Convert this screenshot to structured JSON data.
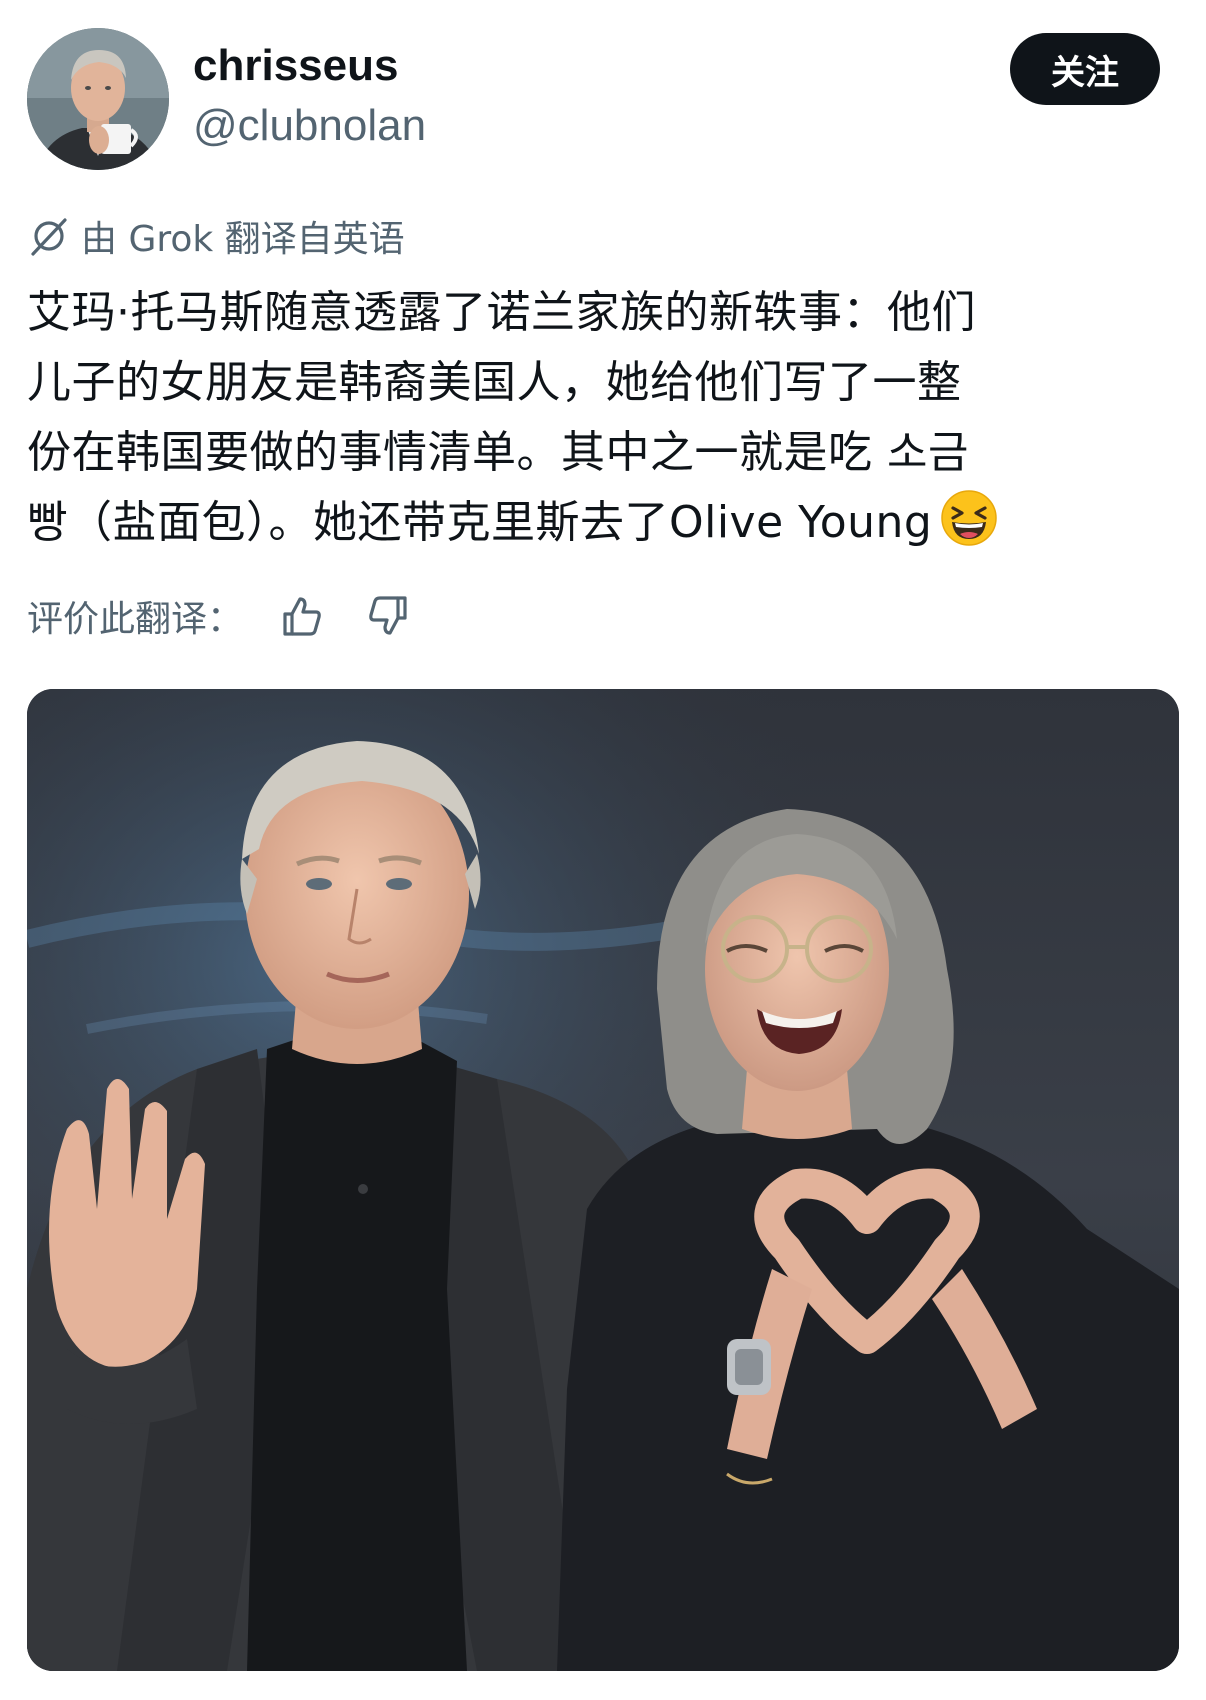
{
  "user": {
    "display_name": "chrisseus",
    "handle": "@clubnolan",
    "avatar_alt": "avatar"
  },
  "follow_button": {
    "label": "关注"
  },
  "translation": {
    "label": "由 Grok 翻译自英语",
    "icon": "grok-icon"
  },
  "tweet": {
    "lines": [
      "艾玛·托马斯随意透露了诺兰家族的新轶事：他们",
      "儿子的女朋友是韩裔美国人，她给他们写了一整",
      "份在韩国要做的事情清单。其中之一就是吃 소금",
      "빵（盐面包）。她还带克里斯去了Olive Young"
    ],
    "emoji": "grinning-squinting-face-emoji"
  },
  "rate_translation": {
    "label": "评价此翻译：",
    "thumbs_up_icon": "thumbs-up-icon",
    "thumbs_down_icon": "thumbs-down-icon"
  },
  "media": {
    "type": "photo",
    "description_icon": "photo"
  },
  "colors": {
    "text_primary": "#0f1419",
    "text_secondary": "#536471",
    "button_bg": "#0f1419",
    "button_text": "#ffffff"
  }
}
